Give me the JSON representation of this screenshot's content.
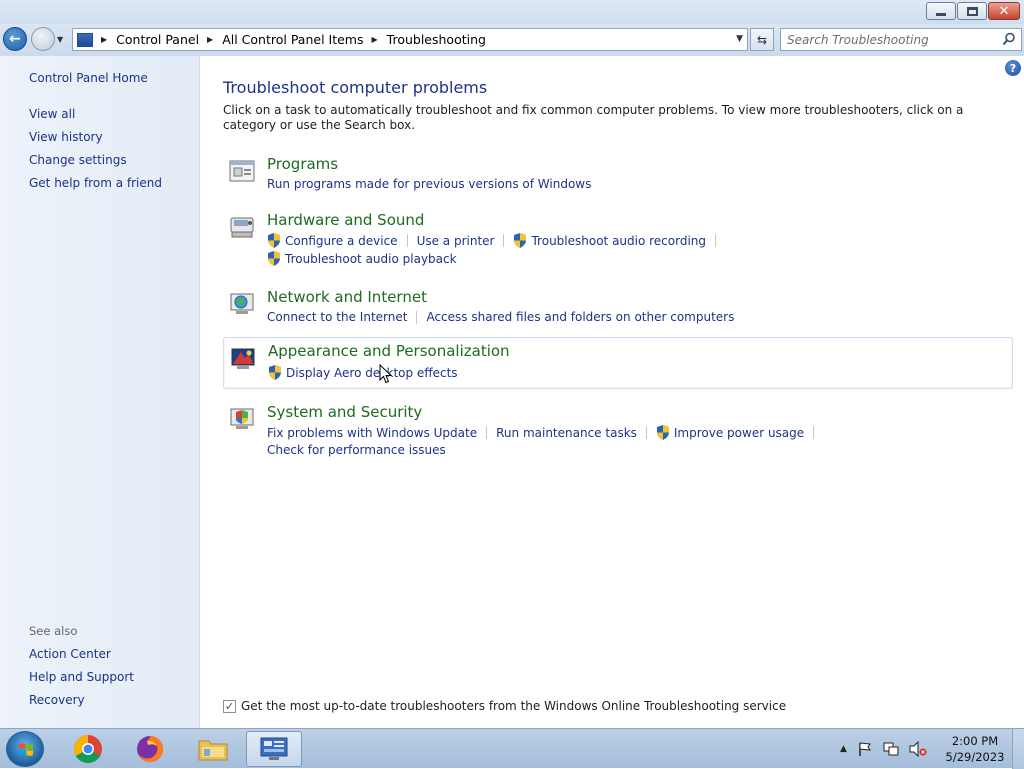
{
  "window": {
    "min_label": "—",
    "close_label": "✕"
  },
  "address": {
    "crumbs": [
      "Control Panel",
      "All Control Panel Items",
      "Troubleshooting"
    ]
  },
  "search": {
    "placeholder": "Search Troubleshooting"
  },
  "left_pane": {
    "home": "Control Panel Home",
    "links": [
      "View all",
      "View history",
      "Change settings",
      "Get help from a friend"
    ],
    "see_also_heading": "See also",
    "see_also": [
      "Action Center",
      "Help and Support",
      "Recovery"
    ]
  },
  "main": {
    "title": "Troubleshoot computer problems",
    "description": "Click on a task to automatically troubleshoot and fix common computer problems. To view more troubleshooters, click on a category or use the Search box.",
    "categories": [
      {
        "title": "Programs",
        "tasks": [
          "Run programs made for previous versions of Windows"
        ]
      },
      {
        "title": "Hardware and Sound",
        "tasks": [
          "Configure a device",
          "Use a printer",
          "Troubleshoot audio recording",
          "Troubleshoot audio playback"
        ]
      },
      {
        "title": "Network and Internet",
        "tasks": [
          "Connect to the Internet",
          "Access shared files and folders on other computers"
        ]
      },
      {
        "title": "Appearance and Personalization",
        "tasks": [
          "Display Aero desktop effects"
        ]
      },
      {
        "title": "System and Security",
        "tasks": [
          "Fix problems with Windows Update",
          "Run maintenance tasks",
          "Improve power usage",
          "Check for performance issues"
        ]
      }
    ],
    "online_check_label": "Get the most up-to-date troubleshooters from the Windows Online Troubleshooting service",
    "online_check_checked": true
  },
  "taskbar": {
    "time": "2:00 PM",
    "date": "5/29/2023"
  },
  "colors": {
    "link": "#1e3287",
    "category_title": "#1d6b21",
    "left_pane_bg": "#e9f0f8"
  }
}
